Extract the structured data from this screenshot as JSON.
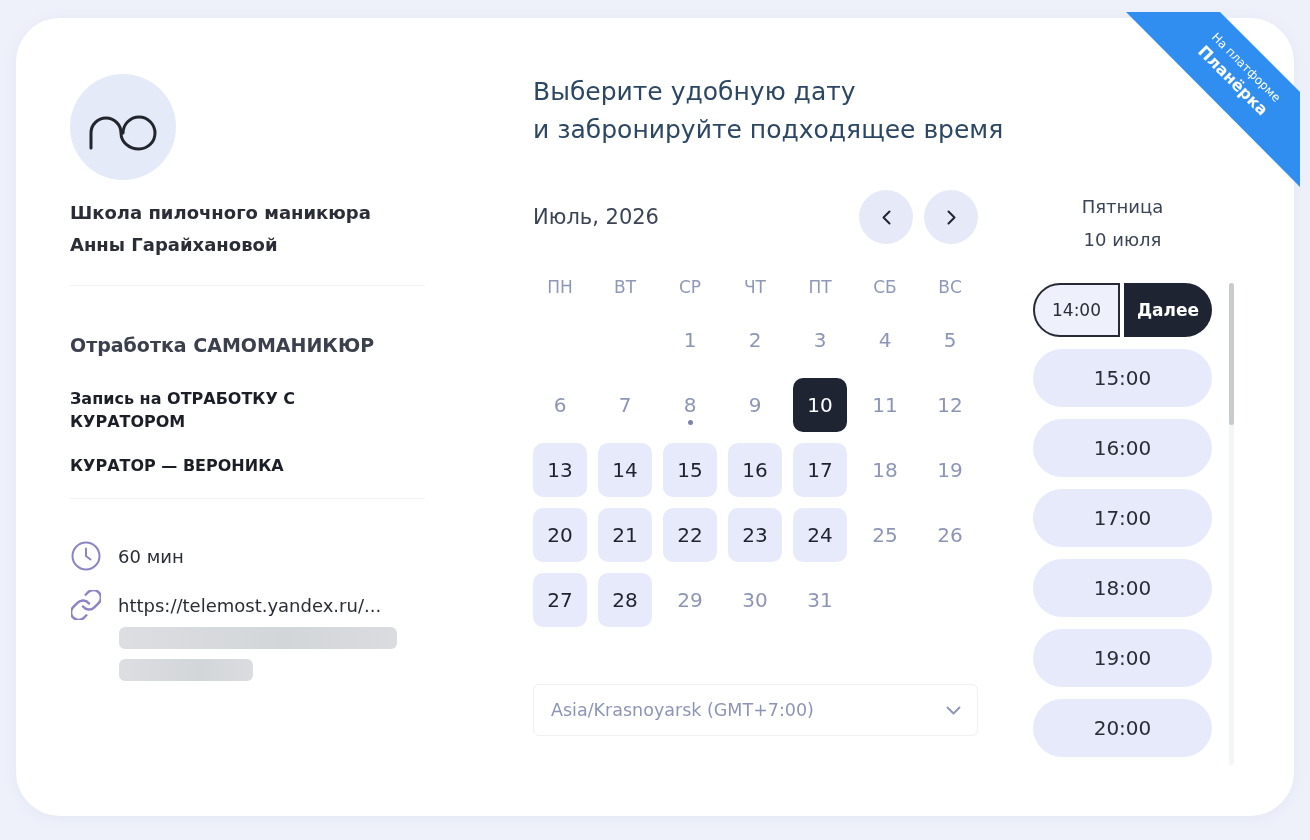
{
  "ribbon": {
    "caption": "На платформе",
    "brand": "Планёрка"
  },
  "organizer": {
    "name": "Школа пилочного маникюра Анны Гарайхановой"
  },
  "event": {
    "title": "Отработка САМОМАНИКЮР",
    "description": [
      "Запись на ОТРАБОТКУ С КУРАТОРОМ",
      "КУРАТОР — ВЕРОНИКА"
    ],
    "duration": "60 мин",
    "link": "https://telemost.yandex.ru/..."
  },
  "heading": "Выберите удобную дату\nи забронируйте подходящее время",
  "calendar": {
    "month": "Июль, 2026",
    "weekdays": [
      "ПН",
      "ВТ",
      "СР",
      "ЧТ",
      "ПТ",
      "СБ",
      "ВС"
    ],
    "weeks": [
      {
        "days": [
          {
            "label": "1",
            "available": false,
            "selected": false,
            "today": false
          },
          {
            "label": "2",
            "available": false,
            "selected": false,
            "today": false
          },
          {
            "label": "3",
            "available": false,
            "selected": false,
            "today": false
          },
          {
            "label": "4",
            "available": false,
            "selected": false,
            "today": false
          },
          {
            "label": "5",
            "available": false,
            "selected": false,
            "today": false
          }
        ]
      },
      {
        "days": [
          {
            "label": "6",
            "available": false,
            "selected": false,
            "today": false
          },
          {
            "label": "7",
            "available": false,
            "selected": false,
            "today": false
          },
          {
            "label": "8",
            "available": false,
            "selected": false,
            "today": true
          },
          {
            "label": "9",
            "available": false,
            "selected": false,
            "today": false
          },
          {
            "label": "10",
            "available": true,
            "selected": true,
            "today": false
          },
          {
            "label": "11",
            "available": false,
            "selected": false,
            "today": false
          },
          {
            "label": "12",
            "available": false,
            "selected": false,
            "today": false
          }
        ]
      },
      {
        "days": [
          {
            "label": "13",
            "available": true,
            "selected": false,
            "today": false
          },
          {
            "label": "14",
            "available": true,
            "selected": false,
            "today": false
          },
          {
            "label": "15",
            "available": true,
            "selected": false,
            "today": false
          },
          {
            "label": "16",
            "available": true,
            "selected": false,
            "today": false
          },
          {
            "label": "17",
            "available": true,
            "selected": false,
            "today": false
          },
          {
            "label": "18",
            "available": false,
            "selected": false,
            "today": false
          },
          {
            "label": "19",
            "available": false,
            "selected": false,
            "today": false
          }
        ]
      },
      {
        "days": [
          {
            "label": "20",
            "available": true,
            "selected": false,
            "today": false
          },
          {
            "label": "21",
            "available": true,
            "selected": false,
            "today": false
          },
          {
            "label": "22",
            "available": true,
            "selected": false,
            "today": false
          },
          {
            "label": "23",
            "available": true,
            "selected": false,
            "today": false
          },
          {
            "label": "24",
            "available": true,
            "selected": false,
            "today": false
          },
          {
            "label": "25",
            "available": false,
            "selected": false,
            "today": false
          },
          {
            "label": "26",
            "available": false,
            "selected": false,
            "today": false
          }
        ]
      },
      {
        "days": [
          {
            "label": "27",
            "available": true,
            "selected": false,
            "today": false
          },
          {
            "label": "28",
            "available": true,
            "selected": false,
            "today": false
          },
          {
            "label": "29",
            "available": false,
            "selected": false,
            "today": false
          },
          {
            "label": "30",
            "available": false,
            "selected": false,
            "today": false
          },
          {
            "label": "31",
            "available": false,
            "selected": false,
            "today": false
          }
        ]
      }
    ]
  },
  "timezone": {
    "value": "Asia/Krasnoyarsk (GMT+7:00)"
  },
  "schedule": {
    "weekday": "Пятница",
    "date": "10 июля",
    "next_button": "Далее",
    "slots": [
      {
        "time": "14:00",
        "selected": true
      },
      {
        "time": "15:00",
        "selected": false
      },
      {
        "time": "16:00",
        "selected": false
      },
      {
        "time": "17:00",
        "selected": false
      },
      {
        "time": "18:00",
        "selected": false
      },
      {
        "time": "19:00",
        "selected": false
      },
      {
        "time": "20:00",
        "selected": false
      }
    ]
  }
}
